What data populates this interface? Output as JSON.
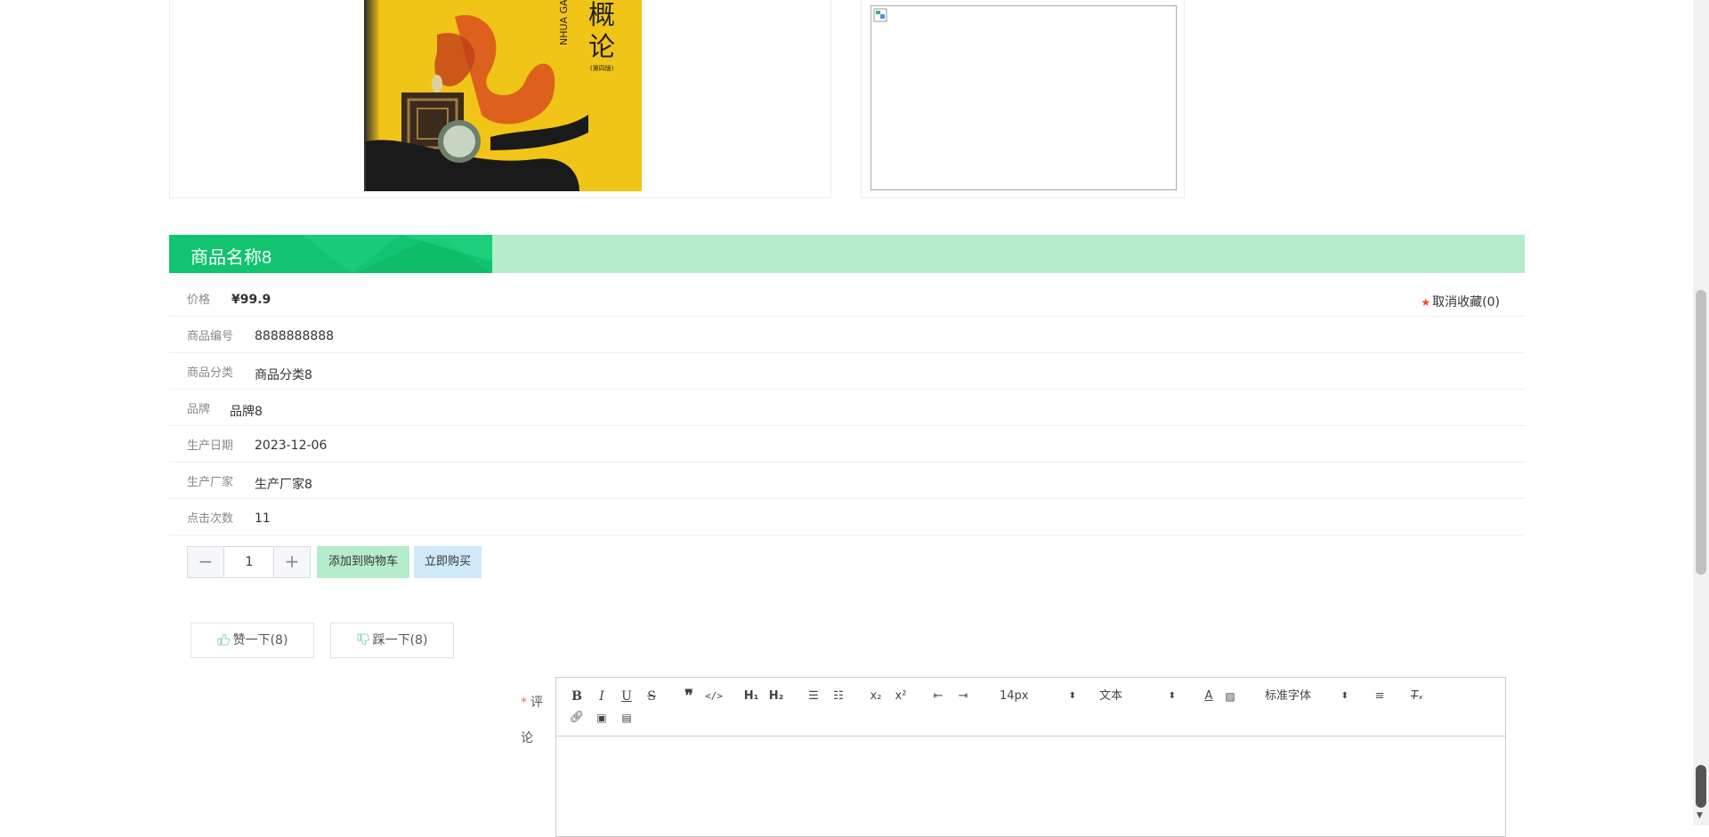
{
  "product": {
    "title": "商品名称8",
    "price_label": "价格",
    "price_value": "¥99.9",
    "favorite_label": "取消收藏(0)",
    "rows": [
      {
        "label": "商品编号",
        "value": "8888888888"
      },
      {
        "label": "商品分类",
        "value": "商品分类8"
      },
      {
        "label": "品牌",
        "value": "品牌8"
      },
      {
        "label": "生产日期",
        "value": "2023-12-06"
      },
      {
        "label": "生产厂家",
        "value": "生产厂家8"
      },
      {
        "label": "点击次数",
        "value": "11"
      }
    ],
    "book_cover_text": {
      "char1": "概",
      "char2": "论",
      "latin": "NHUA GAILUN",
      "edition": "(第四版)"
    }
  },
  "purchase": {
    "minus": "−",
    "quantity": "1",
    "plus": "+",
    "add_to_cart": "添加到购物车",
    "buy_now": "立即购买"
  },
  "votes": {
    "like": "赞一下(8)",
    "dislike": "踩一下(8)"
  },
  "comment": {
    "required_mark": "*",
    "label": "评论",
    "toolbar": {
      "font_size": "14px",
      "header_type": "文本",
      "font_family": "标准字体"
    }
  },
  "colors": {
    "accent_green": "#11c46f",
    "light_green": "#b5eccb",
    "light_blue": "#cfe9fb",
    "star_red": "#f04a25"
  }
}
